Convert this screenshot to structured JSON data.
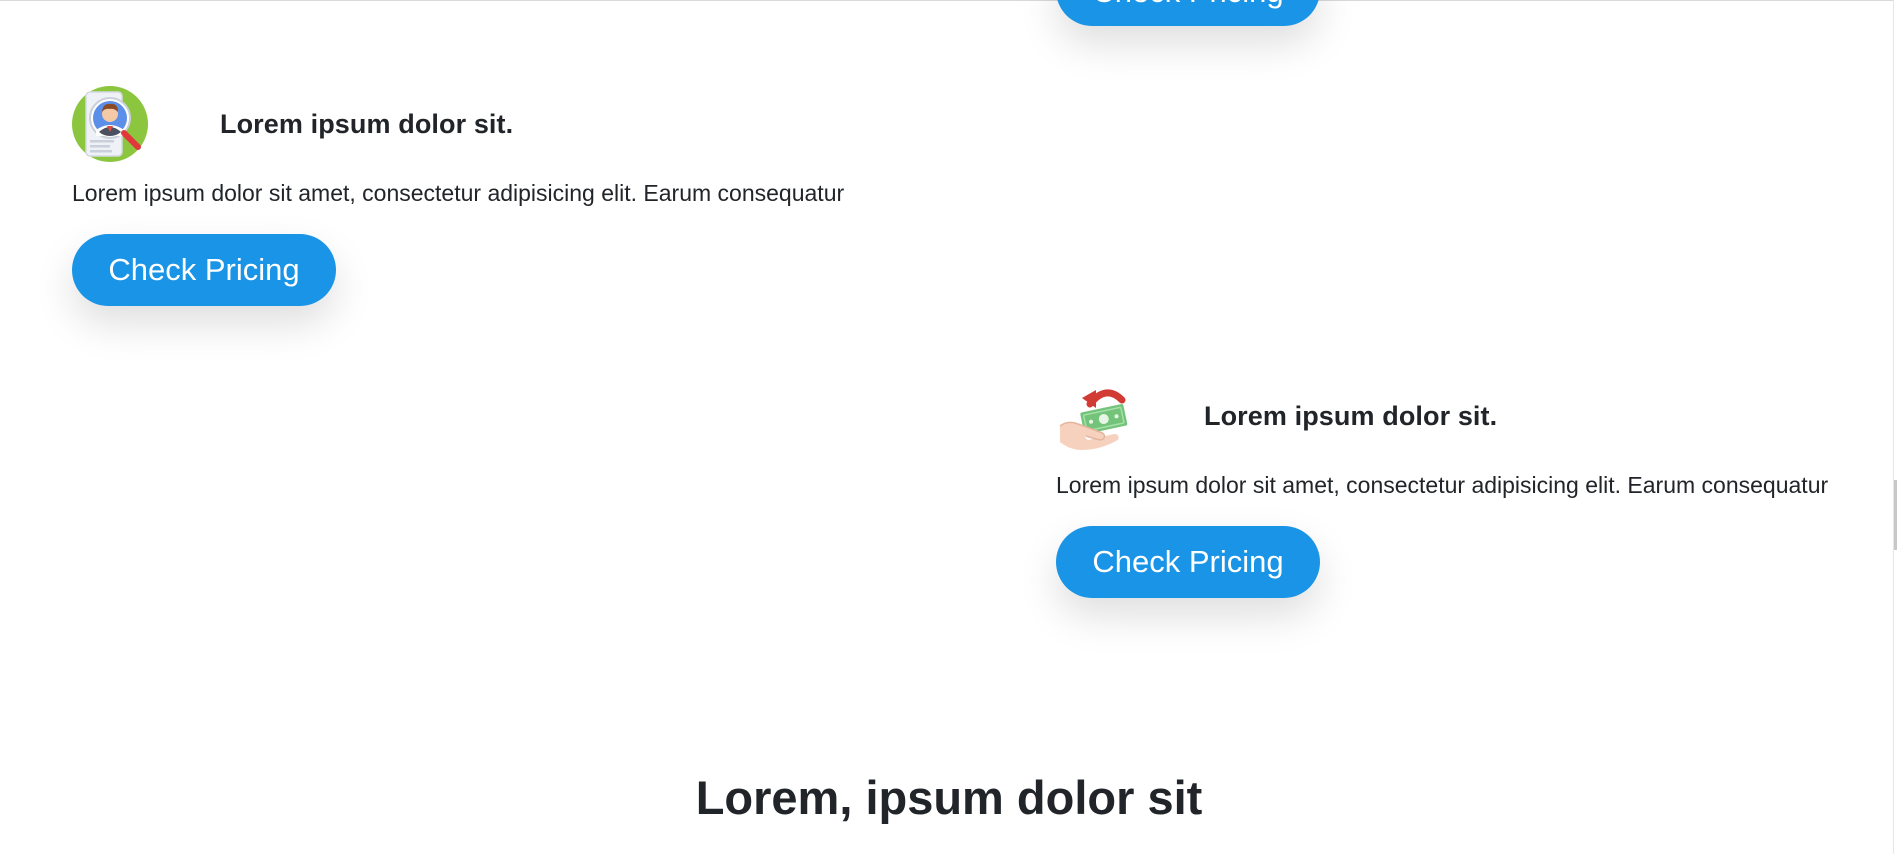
{
  "top_partial_button": {
    "label": "Check Pricing"
  },
  "features": [
    {
      "title": "Lorem ipsum dolor sit.",
      "description": "Lorem ipsum dolor sit amet, consectetur adipisicing elit. Earum consequatur",
      "button_label": "Check Pricing",
      "icon": "candidate-search-icon"
    },
    {
      "title": "Lorem ipsum dolor sit.",
      "description": "Lorem ipsum dolor sit amet, consectetur adipisicing elit. Earum consequatur",
      "button_label": "Check Pricing",
      "icon": "cash-refund-icon"
    }
  ],
  "section": {
    "title": "Lorem, ipsum dolor sit"
  },
  "colors": {
    "button_bg": "#1a94e6",
    "button_text": "#ffffff",
    "text": "#212529",
    "background": "#ffffff"
  }
}
